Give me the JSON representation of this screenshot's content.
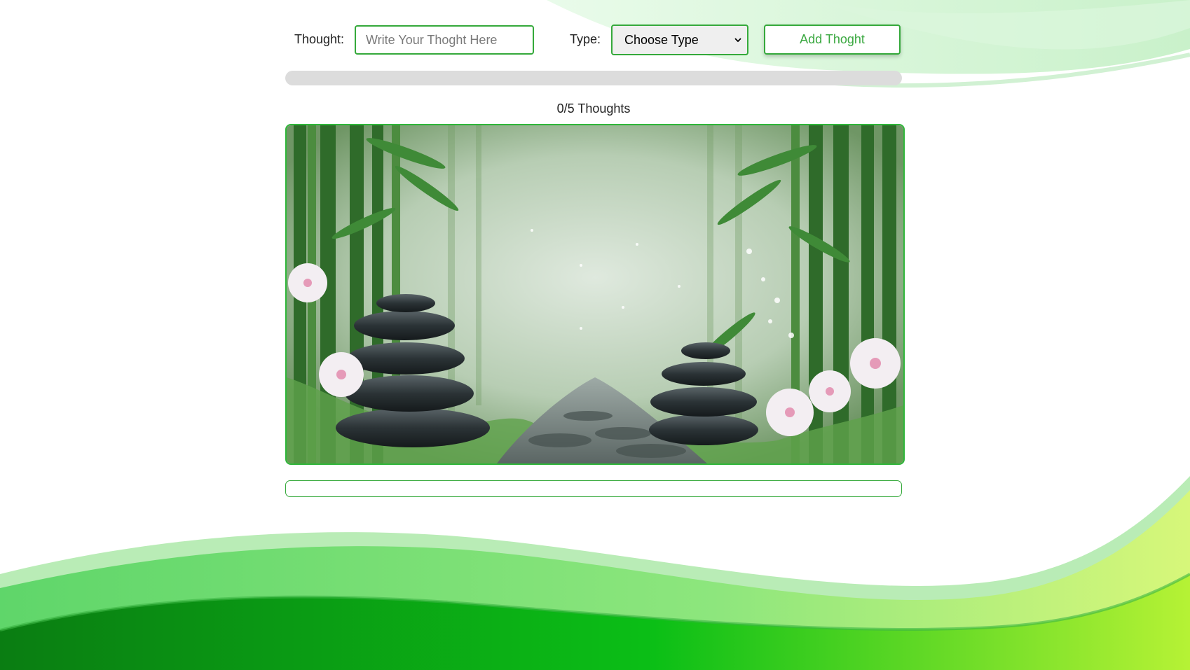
{
  "form": {
    "thought_label": "Thought:",
    "thought_placeholder": "Write Your Thoght Here",
    "thought_value": "",
    "type_label": "Type:",
    "type_selected": "Choose Type",
    "add_button_label": "Add Thoght"
  },
  "progress": {
    "current": 0,
    "total": 5,
    "fraction": 0,
    "counter_text": "0/5 Thoughts"
  },
  "colors": {
    "accent": "#35a93b",
    "track": "#dcdcdc",
    "wave_dark": "#0a9a14",
    "wave_light": "#aef0b0",
    "wave_lime": "#b9f43a"
  },
  "hero_image": {
    "subject": "zen-garden-bamboo-stones"
  },
  "thoughts_list": []
}
